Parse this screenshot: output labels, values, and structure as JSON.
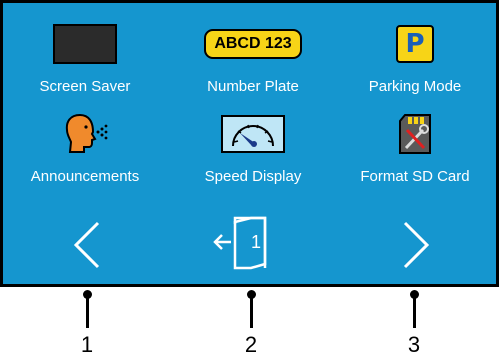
{
  "tiles": [
    {
      "id": "screen_saver",
      "label": "Screen Saver",
      "icon": "screen-saver-icon"
    },
    {
      "id": "number_plate",
      "label": "Number Plate",
      "icon": "number-plate-icon",
      "plate_text": "ABCD 123"
    },
    {
      "id": "parking_mode",
      "label": "Parking Mode",
      "icon": "parking-icon",
      "icon_text": "P"
    },
    {
      "id": "announcements",
      "label": "Announcements",
      "icon": "speaking-head-icon"
    },
    {
      "id": "speed_display",
      "label": "Speed Display",
      "icon": "speedometer-icon"
    },
    {
      "id": "format_sd_card",
      "label": "Format SD Card",
      "icon": "sd-card-tools-icon"
    }
  ],
  "nav": {
    "prev_icon": "chevron-left-icon",
    "exit_icon": "exit-door-icon",
    "exit_number": "1",
    "next_icon": "chevron-right-icon"
  },
  "callouts": [
    "1",
    "2",
    "3"
  ],
  "colors": {
    "screen_bg": "#1596cf",
    "accent_yellow": "#f7d417",
    "text": "#ffffff"
  }
}
